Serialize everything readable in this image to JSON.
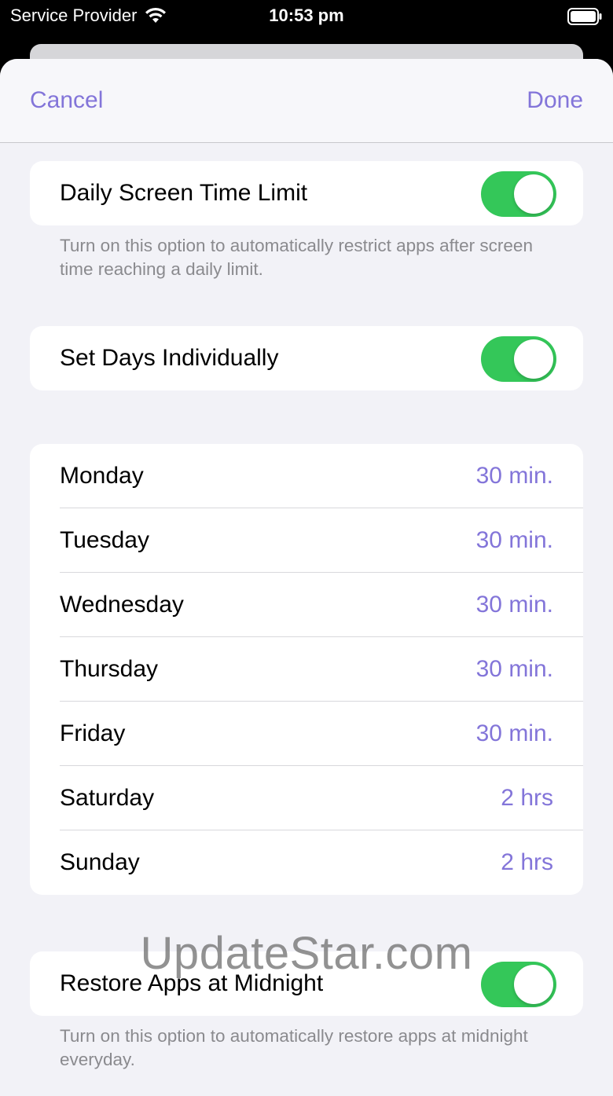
{
  "status_bar": {
    "carrier": "Service Provider",
    "time": "10:53 pm"
  },
  "nav": {
    "cancel_label": "Cancel",
    "done_label": "Done"
  },
  "daily_limit": {
    "label": "Daily Screen Time Limit",
    "enabled": true,
    "footnote": "Turn on this option to automatically restrict apps after screen time reaching a daily limit."
  },
  "set_days": {
    "label": "Set Days Individually",
    "enabled": true
  },
  "days": [
    {
      "name": "Monday",
      "value": "30 min."
    },
    {
      "name": "Tuesday",
      "value": "30 min."
    },
    {
      "name": "Wednesday",
      "value": "30 min."
    },
    {
      "name": "Thursday",
      "value": "30 min."
    },
    {
      "name": "Friday",
      "value": "30 min."
    },
    {
      "name": "Saturday",
      "value": "2 hrs"
    },
    {
      "name": "Sunday",
      "value": "2 hrs"
    }
  ],
  "restore": {
    "label": "Restore Apps at Midnight",
    "enabled": true,
    "footnote": "Turn on this option to automatically restore apps at midnight everyday."
  },
  "watermark": "UpdateStar.com",
  "colors": {
    "accent": "#8375d9",
    "toggle_on": "#34c759",
    "background": "#f2f2f7"
  }
}
